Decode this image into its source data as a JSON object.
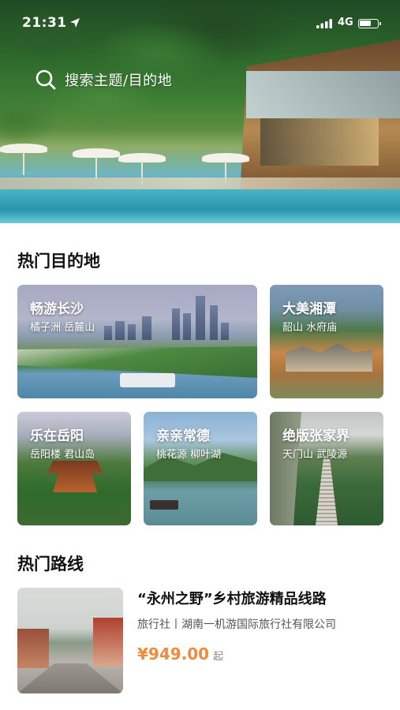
{
  "status_bar": {
    "time": "21:31",
    "network": "4G"
  },
  "search": {
    "placeholder": "搜索主题/目的地"
  },
  "sections": {
    "destinations_title": "热门目的地",
    "routes_title": "热门路线"
  },
  "destinations": [
    {
      "title": "畅游长沙",
      "subtitle": "橘子洲 岳麓山"
    },
    {
      "title": "大美湘潭",
      "subtitle": "韶山 水府庙"
    },
    {
      "title": "乐在岳阳",
      "subtitle": "岳阳楼 君山岛"
    },
    {
      "title": "亲亲常德",
      "subtitle": "桃花源 柳叶湖"
    },
    {
      "title": "绝版张家界",
      "subtitle": "天门山 武陵源"
    }
  ],
  "routes": [
    {
      "title": "“永州之野”乡村旅游精品线路",
      "agency": "旅行社丨湖南一机游国际旅行社有限公司",
      "price": "¥949.00",
      "price_suffix": "起"
    }
  ],
  "colors": {
    "price": "#f08a3c",
    "title": "#111111"
  },
  "icons": {
    "search": "search-icon",
    "location": "location-arrow-icon",
    "signal": "signal-icon",
    "battery": "battery-icon"
  }
}
